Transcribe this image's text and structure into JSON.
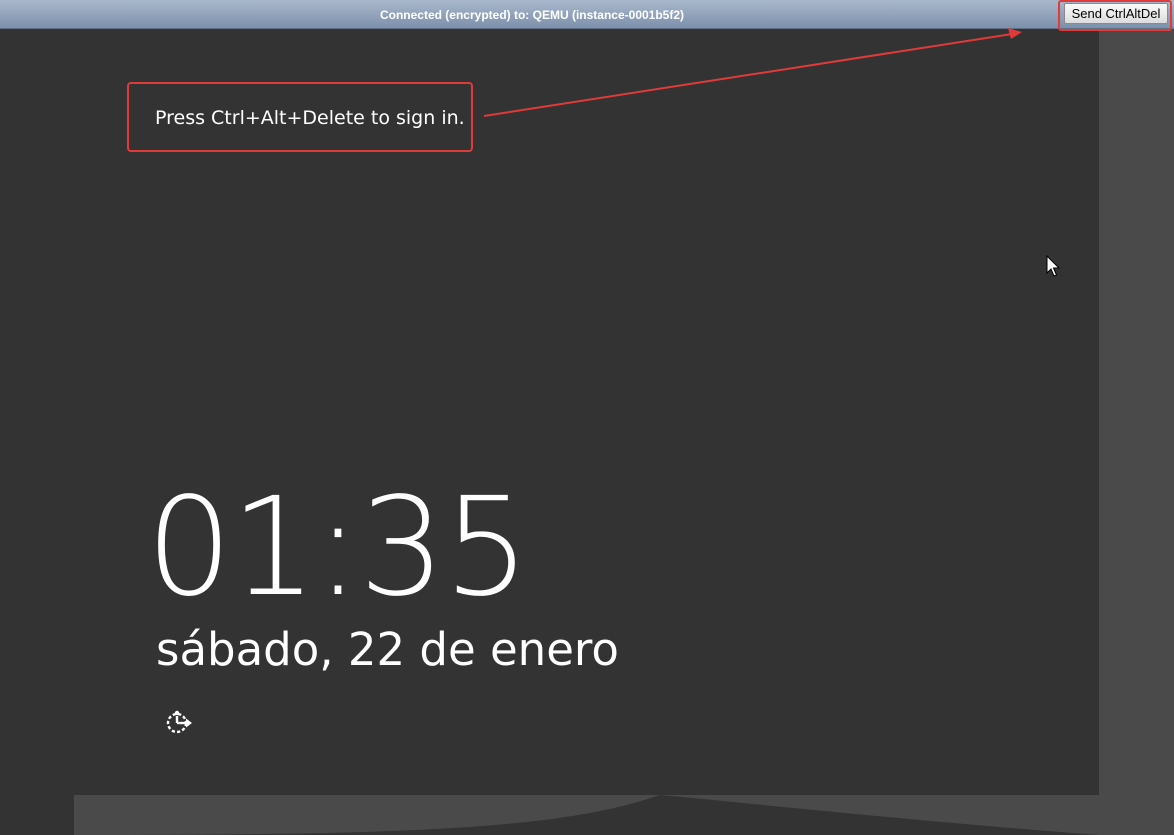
{
  "window": {
    "status_text": "Connected (encrypted) to: QEMU (instance-0001b5f2)",
    "send_button_label": "Send CtrlAltDel"
  },
  "lock_screen": {
    "time": "01:35",
    "date": "sábado, 22 de enero",
    "accessibility_icon": "ease-of-access-icon"
  },
  "annotation": {
    "callout_text": "Press Ctrl+Alt+Delete to sign in.",
    "highlight_color": "#e03a3a"
  },
  "colors": {
    "screen_background": "#333333",
    "outer_background": "#4a4a4a",
    "status_bar": "#8fa0b8",
    "text": "#ffffff"
  }
}
